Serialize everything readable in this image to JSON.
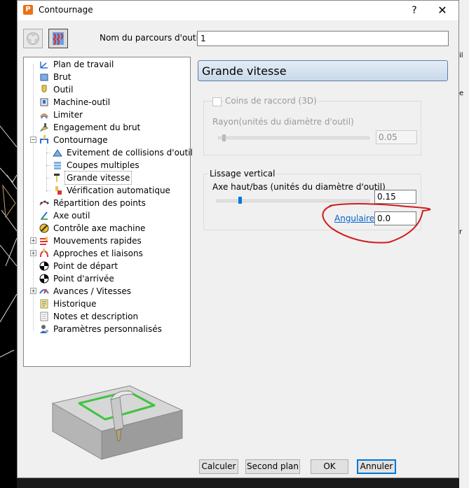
{
  "window": {
    "title": "Contournage",
    "help": "?",
    "close": "✕"
  },
  "toolpath_name": {
    "label": "Nom du parcours d'outil",
    "value": "1"
  },
  "tree": {
    "items": [
      {
        "label": "Plan de travail"
      },
      {
        "label": "Brut"
      },
      {
        "label": "Outil"
      },
      {
        "label": "Machine-outil"
      },
      {
        "label": "Limiter"
      },
      {
        "label": "Engagement du brut"
      },
      {
        "label": "Contournage"
      },
      {
        "label": "Evitement de collisions d'outil"
      },
      {
        "label": "Coupes multiples"
      },
      {
        "label": "Grande vitesse"
      },
      {
        "label": "Vérification automatique"
      },
      {
        "label": "Répartition des points"
      },
      {
        "label": "Axe outil"
      },
      {
        "label": "Contrôle axe machine"
      },
      {
        "label": "Mouvements rapides"
      },
      {
        "label": "Approches et liaisons"
      },
      {
        "label": "Point de départ"
      },
      {
        "label": "Point d'arrivée"
      },
      {
        "label": "Avances / Vitesses"
      },
      {
        "label": "Historique"
      },
      {
        "label": "Notes et description"
      },
      {
        "label": "Paramètres personnalisés"
      }
    ]
  },
  "panel": {
    "title": "Grande vitesse",
    "corners": {
      "checkbox_label": "Coins de raccord (3D)",
      "checked": false,
      "radius_label": "Rayon(unités du diamètre d'outil)",
      "radius_value": "0.05"
    },
    "vertical_smoothing": {
      "legend": "Lissage vertical",
      "axis_label": "Axe haut/bas (unités du diamètre d'outil)",
      "axis_value": "0.15",
      "angular_link": "Angulaire",
      "angular_value": "0.0"
    }
  },
  "buttons": {
    "calculate": "Calculer",
    "background": "Second plan",
    "ok": "OK",
    "cancel": "Annuler"
  },
  "side_fragments": [
    "il",
    "e",
    "r"
  ],
  "colors": {
    "header_bg": "#c9d9ea",
    "link": "#0066cc",
    "annotation": "#d11a1a",
    "selection_frame": "#2fbf2f"
  }
}
